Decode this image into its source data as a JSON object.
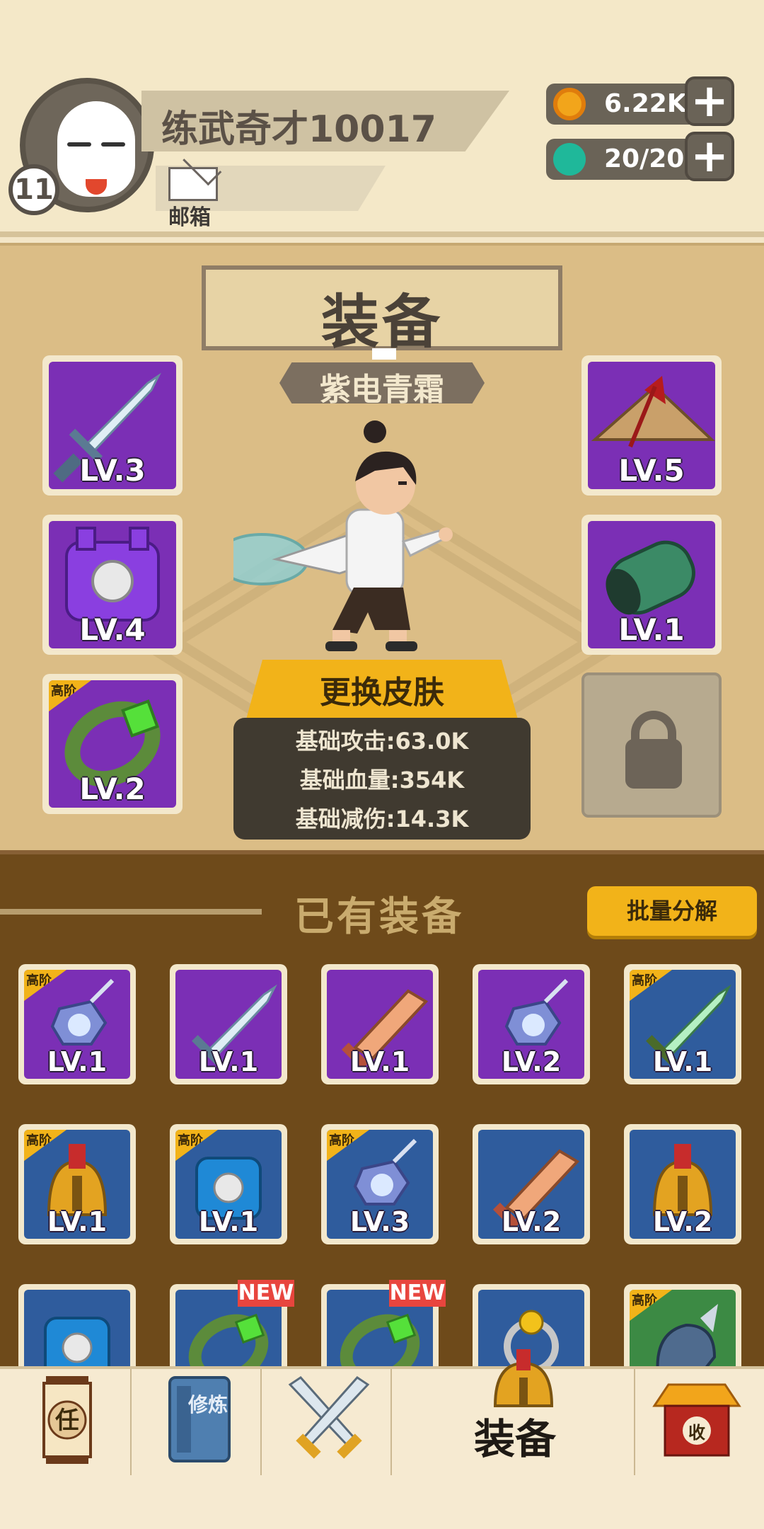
{
  "header": {
    "player_name": "练武奇才10017",
    "player_level": "11",
    "mail_label": "邮箱",
    "coins": "6.22K",
    "stamina": "20/20"
  },
  "equipment": {
    "title": "装备",
    "skin_name": "紫电青霜",
    "change_skin_label": "更换皮肤",
    "stats": [
      "基础攻击:63.0K",
      "基础血量:354K",
      "基础减伤:14.3K"
    ],
    "slots": [
      {
        "level": "LV.3",
        "rarity_color": "purple",
        "icon": "sword-icon",
        "tier": ""
      },
      {
        "level": "LV.4",
        "rarity_color": "purple",
        "icon": "armor-icon",
        "tier": ""
      },
      {
        "level": "LV.2",
        "rarity_color": "purple",
        "icon": "bracelet-icon",
        "tier": "高阶"
      },
      {
        "level": "LV.5",
        "rarity_color": "purple",
        "icon": "hat-icon",
        "tier": ""
      },
      {
        "level": "LV.1",
        "rarity_color": "purple",
        "icon": "bracer-icon",
        "tier": ""
      }
    ]
  },
  "owned": {
    "title": "已有装备",
    "batch_decompose_label": "批量分解",
    "items": [
      {
        "level": "LV.1",
        "bg": "purple",
        "icon": "amulet-icon",
        "tier": "高阶",
        "new": ""
      },
      {
        "level": "LV.1",
        "bg": "purple",
        "icon": "sword-icon",
        "tier": "",
        "new": ""
      },
      {
        "level": "LV.1",
        "bg": "purple",
        "icon": "broad-sword-icon",
        "tier": "",
        "new": ""
      },
      {
        "level": "LV.2",
        "bg": "purple",
        "icon": "amulet-icon",
        "tier": "",
        "new": ""
      },
      {
        "level": "LV.1",
        "bg": "blue",
        "icon": "jade-sword-icon",
        "tier": "高阶",
        "new": ""
      },
      {
        "level": "LV.1",
        "bg": "blue",
        "icon": "helmet-icon",
        "tier": "高阶",
        "new": ""
      },
      {
        "level": "LV.1",
        "bg": "blue",
        "icon": "armor-icon",
        "tier": "高阶",
        "new": ""
      },
      {
        "level": "LV.3",
        "bg": "blue",
        "icon": "amulet-icon",
        "tier": "高阶",
        "new": ""
      },
      {
        "level": "LV.2",
        "bg": "blue",
        "icon": "broad-sword-icon",
        "tier": "",
        "new": ""
      },
      {
        "level": "LV.2",
        "bg": "blue",
        "icon": "helmet-icon",
        "tier": "",
        "new": ""
      },
      {
        "level": "",
        "bg": "blue",
        "icon": "armor-icon",
        "tier": "",
        "new": ""
      },
      {
        "level": "",
        "bg": "blue",
        "icon": "bracelet-icon",
        "tier": "",
        "new": "NEW"
      },
      {
        "level": "",
        "bg": "blue",
        "icon": "bracelet-icon",
        "tier": "",
        "new": "NEW"
      },
      {
        "level": "",
        "bg": "blue",
        "icon": "ring-icon",
        "tier": "",
        "new": ""
      },
      {
        "level": "",
        "bg": "green",
        "icon": "gauntlet-icon",
        "tier": "高阶",
        "new": ""
      }
    ]
  },
  "nav": {
    "task_glyph": "任",
    "cultivate_glyph": "修炼",
    "shop_glyph": "收",
    "active_label": "装备"
  },
  "colors": {
    "gold_button": "#f2b319",
    "purple_rarity": "#7b2fb5",
    "blue_rarity": "#2f5c9d",
    "green_rarity": "#3c8a44"
  }
}
